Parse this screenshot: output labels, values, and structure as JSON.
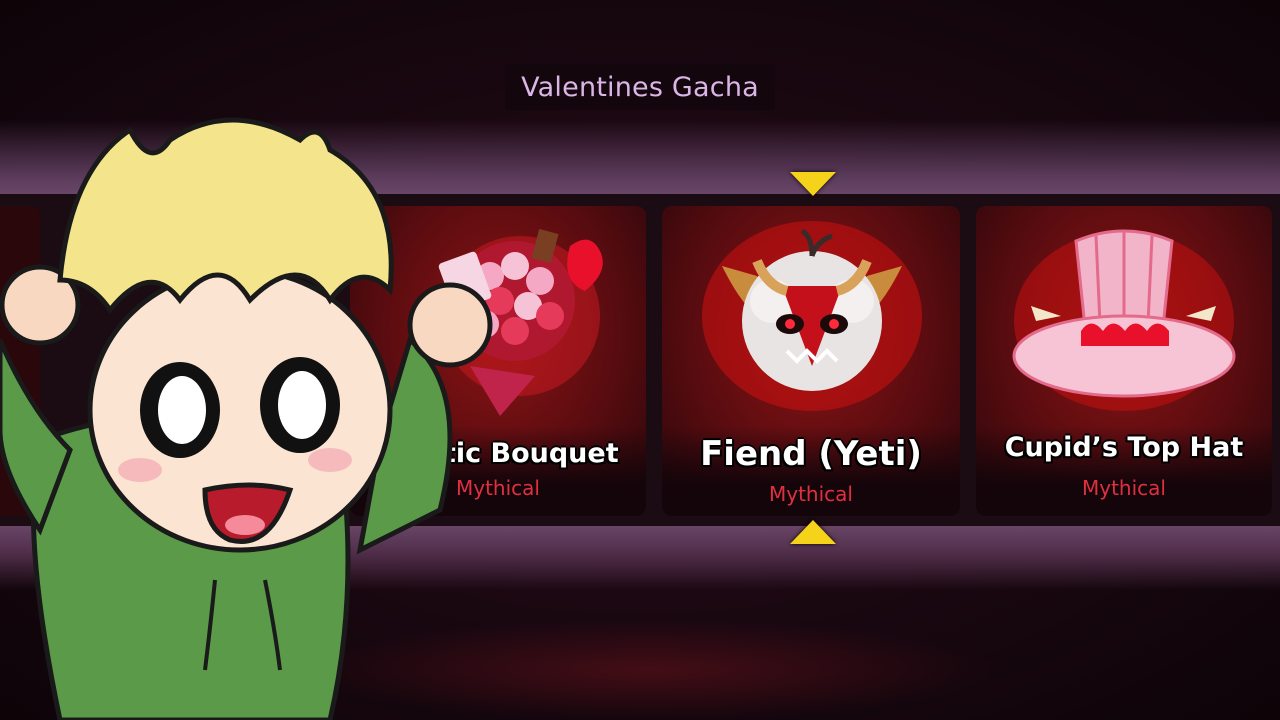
{
  "title": "Valentines Gacha",
  "cards": [
    {
      "name": "Romantic Bouquet",
      "visible_name": "mantic Bouquet",
      "rarity": "Mythical"
    },
    {
      "name": "Fiend (Yeti)",
      "visible_name": "Fiend (Yeti)",
      "rarity": "Mythical"
    },
    {
      "name": "Cupid’s Top Hat",
      "visible_name": "Cupid’s Top Hat",
      "rarity": "Mythical"
    }
  ],
  "colors": {
    "rarity_mythical": "#e03040",
    "selector_arrow": "#f5d31a",
    "title_text": "#d9b6e6",
    "card_glow": "#8c1414"
  },
  "icons": {
    "selector_top": "triangle-down",
    "selector_bottom": "triangle-up"
  }
}
